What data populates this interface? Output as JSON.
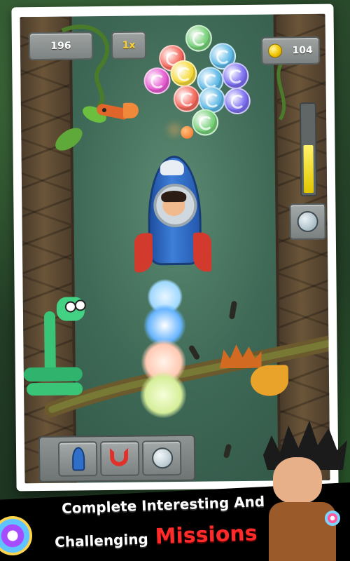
{
  "hud": {
    "score": "196",
    "multiplier": "1x",
    "coins": "104"
  },
  "power_gauge": {
    "level": 0.55
  },
  "powerup_slots": [
    {
      "icon": "rocket-icon"
    },
    {
      "icon": "magnet-icon"
    },
    {
      "icon": "shield-bubble-icon"
    }
  ],
  "bubble_cluster": [
    {
      "color": "#77d07a"
    },
    {
      "color": "#5fb9e6"
    },
    {
      "color": "#f36a5e"
    },
    {
      "color": "#e65bd1"
    },
    {
      "color": "#f5da3c"
    },
    {
      "color": "#5fb9e6"
    },
    {
      "color": "#7c6ff0"
    },
    {
      "color": "#f36a5e"
    },
    {
      "color": "#5fb9e6"
    },
    {
      "color": "#7c6ff0"
    },
    {
      "color": "#77d07a"
    }
  ],
  "banner": {
    "line1": "Complete Interesting And",
    "line2": "Challenging",
    "highlight": "Missions"
  },
  "colors": {
    "banner_bg": "#000000",
    "highlight": "#ff2a2a",
    "hud_plate": "#8d9291",
    "multiplier": "#f7d23a",
    "rocket_body": "#2f6fc9",
    "rocket_fin": "#d23a2e"
  }
}
